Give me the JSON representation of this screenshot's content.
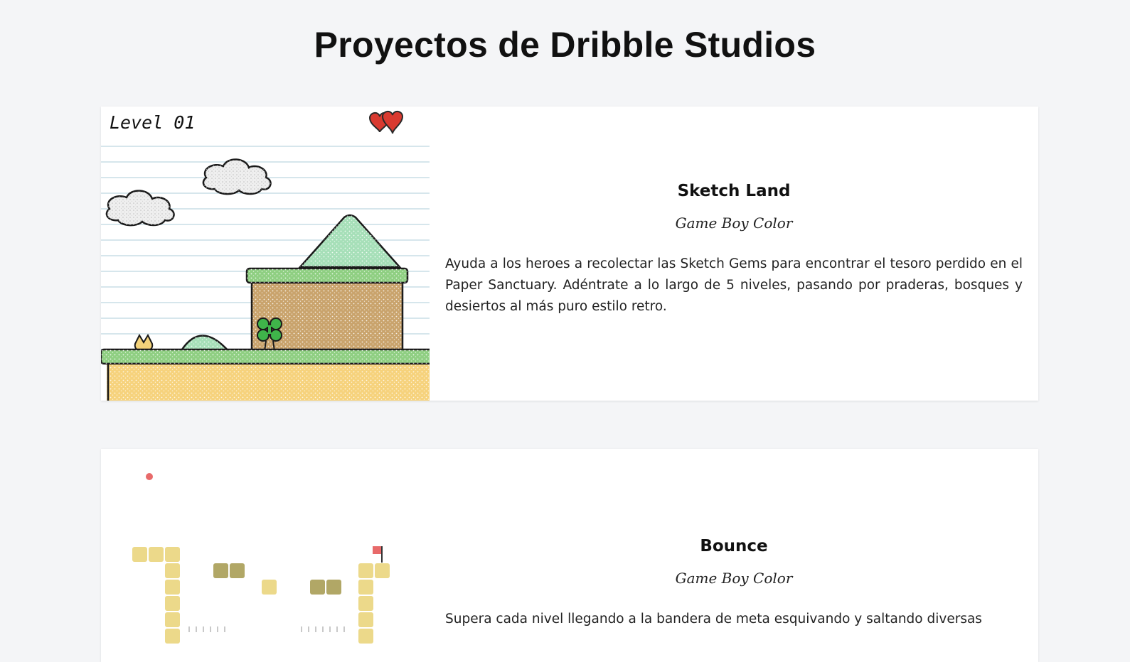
{
  "page": {
    "title": "Proyectos de Dribble Studios"
  },
  "projects": [
    {
      "title": "Sketch Land",
      "platform": "Game Boy Color",
      "description": "Ayuda a los heroes a recolectar las Sketch Gems para encontrar el tesoro perdido en el Paper Sanctuary. Adéntrate a lo largo de 5 niveles, pasando por praderas, bosques y desiertos al más puro estilo retro.",
      "thumbnail": {
        "hud_label": "Level 01",
        "icons": [
          "heart-icon",
          "heart-icon"
        ]
      }
    },
    {
      "title": "Bounce",
      "platform": "Game Boy Color",
      "description": "Supera cada nivel llegando a la bandera de meta esquivando y saltando diversas",
      "thumbnail": {
        "icons": [
          "ball-icon",
          "goal-flag-icon"
        ]
      }
    }
  ],
  "colors": {
    "background": "#f4f5f7",
    "card": "#ffffff",
    "grass": "#8fcf82",
    "dirt": "#c9a36c",
    "sand": "#f6d27c",
    "hill": "#a6dfb8",
    "heart": "#d93a30",
    "block": "#ecd98a",
    "block_dark": "#b1a766",
    "ball": "#e86a6a"
  }
}
